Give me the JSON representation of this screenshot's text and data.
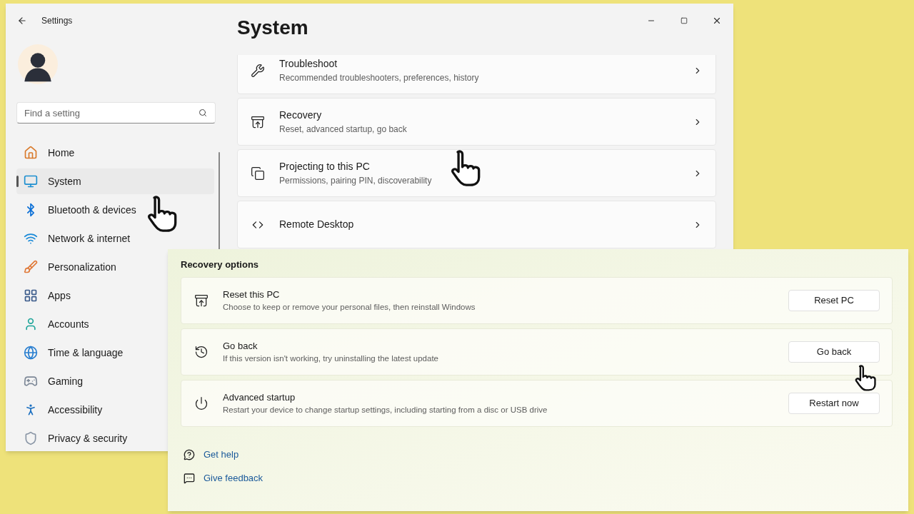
{
  "window": {
    "title": "Settings"
  },
  "search": {
    "placeholder": "Find a setting"
  },
  "sidebar": {
    "items": [
      {
        "label": "Home",
        "selected": false
      },
      {
        "label": "System",
        "selected": true
      },
      {
        "label": "Bluetooth & devices",
        "selected": false
      },
      {
        "label": "Network & internet",
        "selected": false
      },
      {
        "label": "Personalization",
        "selected": false
      },
      {
        "label": "Apps",
        "selected": false
      },
      {
        "label": "Accounts",
        "selected": false
      },
      {
        "label": "Time & language",
        "selected": false
      },
      {
        "label": "Gaming",
        "selected": false
      },
      {
        "label": "Accessibility",
        "selected": false
      },
      {
        "label": "Privacy & security",
        "selected": false
      }
    ]
  },
  "page": {
    "title": "System",
    "cards": [
      {
        "title": "Troubleshoot",
        "subtitle": "Recommended troubleshooters, preferences, history"
      },
      {
        "title": "Recovery",
        "subtitle": "Reset, advanced startup, go back"
      },
      {
        "title": "Projecting to this PC",
        "subtitle": "Permissions, pairing PIN, discoverability"
      },
      {
        "title": "Remote Desktop"
      }
    ]
  },
  "recovery": {
    "heading": "Recovery options",
    "options": [
      {
        "title": "Reset this PC",
        "description": "Choose to keep or remove your personal files, then reinstall Windows",
        "button": "Reset PC"
      },
      {
        "title": "Go back",
        "description": "If this version isn't working, try uninstalling the latest update",
        "button": "Go back"
      },
      {
        "title": "Advanced startup",
        "description": "Restart your device to change startup settings, including starting from a disc or USB drive",
        "button": "Restart now"
      }
    ],
    "links": [
      "Get help",
      "Give feedback"
    ]
  }
}
